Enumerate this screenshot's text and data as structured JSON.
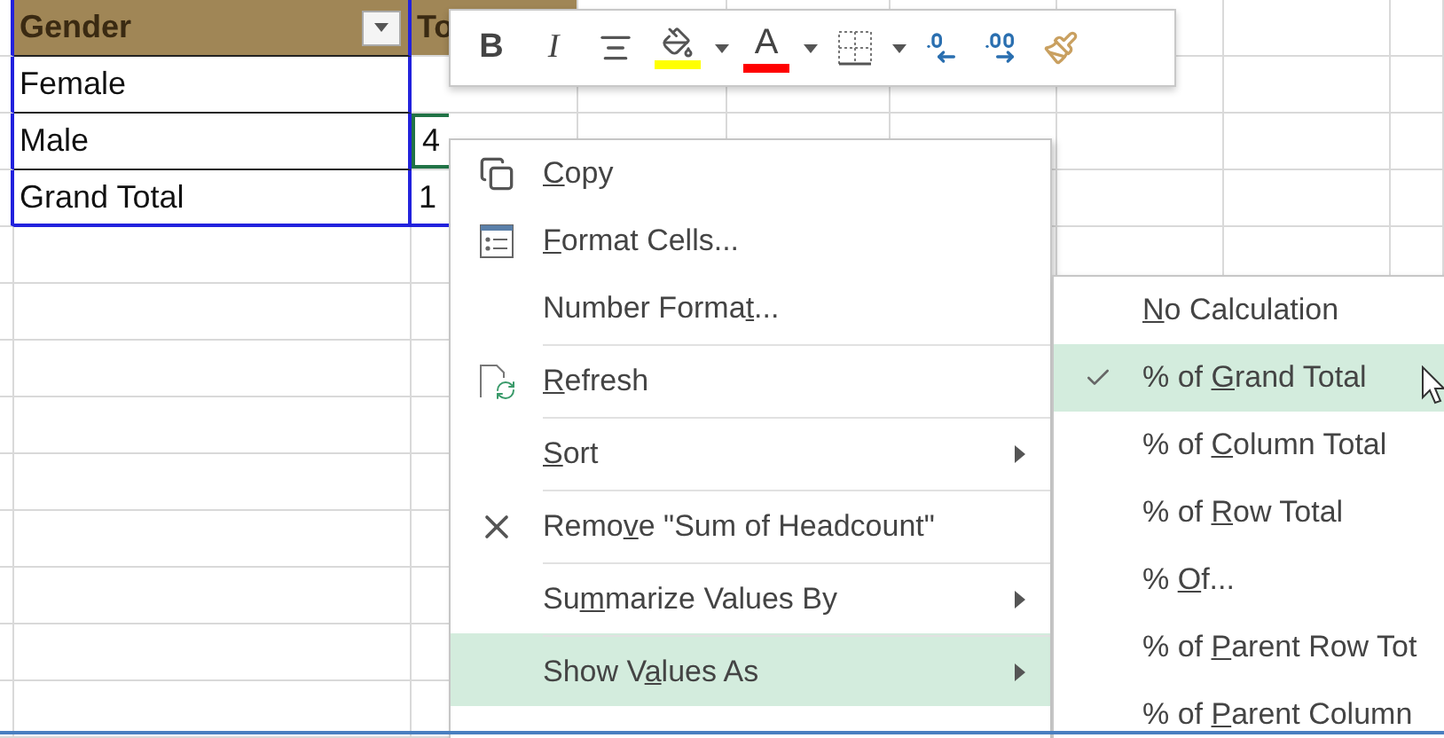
{
  "sheet": {
    "header": [
      {
        "text": "Gender",
        "filter": true
      },
      {
        "text": "To"
      }
    ],
    "rows": [
      {
        "label": "Female"
      },
      {
        "label": "Male",
        "value": "4",
        "selected": true
      },
      {
        "label": "Grand Total",
        "value": "1",
        "selected": false
      }
    ]
  },
  "mini_toolbar": {
    "items": [
      {
        "kind": "bold",
        "label": "B"
      },
      {
        "kind": "italic",
        "label": "I"
      },
      {
        "kind": "align"
      },
      {
        "kind": "fill",
        "color": "#ffff00"
      },
      {
        "kind": "caret"
      },
      {
        "kind": "font_color",
        "label": "A",
        "color": "#ff0000"
      },
      {
        "kind": "caret"
      },
      {
        "kind": "borders"
      },
      {
        "kind": "caret"
      },
      {
        "kind": "increase_decimal"
      },
      {
        "kind": "decrease_decimal"
      },
      {
        "kind": "format_painter"
      }
    ]
  },
  "context_menu": {
    "items": [
      {
        "kind": "copy",
        "key": "C",
        "post": "opy",
        "submenu": false,
        "selected": false,
        "divider_above": false
      },
      {
        "kind": "format_cells",
        "key": "F",
        "post": "ormat Cells...",
        "submenu": false,
        "selected": false,
        "divider_above": false
      },
      {
        "kind": "none",
        "pre": "Number Forma",
        "key": "t",
        "post": "...",
        "submenu": false,
        "selected": false,
        "divider_above": false
      },
      {
        "kind": "refresh",
        "key": "R",
        "post": "efresh",
        "submenu": false,
        "selected": false,
        "divider_above": true
      },
      {
        "kind": "none",
        "key": "S",
        "post": "ort",
        "submenu": true,
        "selected": false,
        "divider_above": true
      },
      {
        "kind": "remove",
        "pre": "Remo",
        "key": "v",
        "post": "e \"Sum of Headcount\"",
        "submenu": false,
        "selected": false,
        "divider_above": true
      },
      {
        "kind": "none",
        "pre": "Su",
        "key": "m",
        "post": "marize Values By",
        "submenu": true,
        "selected": false,
        "divider_above": true
      },
      {
        "kind": "none",
        "pre": "Show V",
        "key": "a",
        "post": "lues As",
        "submenu": true,
        "selected": true,
        "divider_above": true
      }
    ]
  },
  "submenu": {
    "items": [
      {
        "key": "N",
        "post": "o Calculation",
        "checked": false,
        "selected": false
      },
      {
        "pre": "% of ",
        "key": "G",
        "post": "rand Total",
        "checked": true,
        "selected": true
      },
      {
        "pre": "% of ",
        "key": "C",
        "post": "olumn Total",
        "checked": false,
        "selected": false
      },
      {
        "pre": "% of ",
        "key": "R",
        "post": "ow Total",
        "checked": false,
        "selected": false
      },
      {
        "pre": "% ",
        "key": "O",
        "post": "f...",
        "checked": false,
        "selected": false
      },
      {
        "pre": "% of ",
        "key": "P",
        "post": "arent Row Tot",
        "checked": false,
        "selected": false
      },
      {
        "pre": "% of ",
        "key": "P",
        "post": "arent Column",
        "checked": false,
        "selected": false
      }
    ]
  }
}
